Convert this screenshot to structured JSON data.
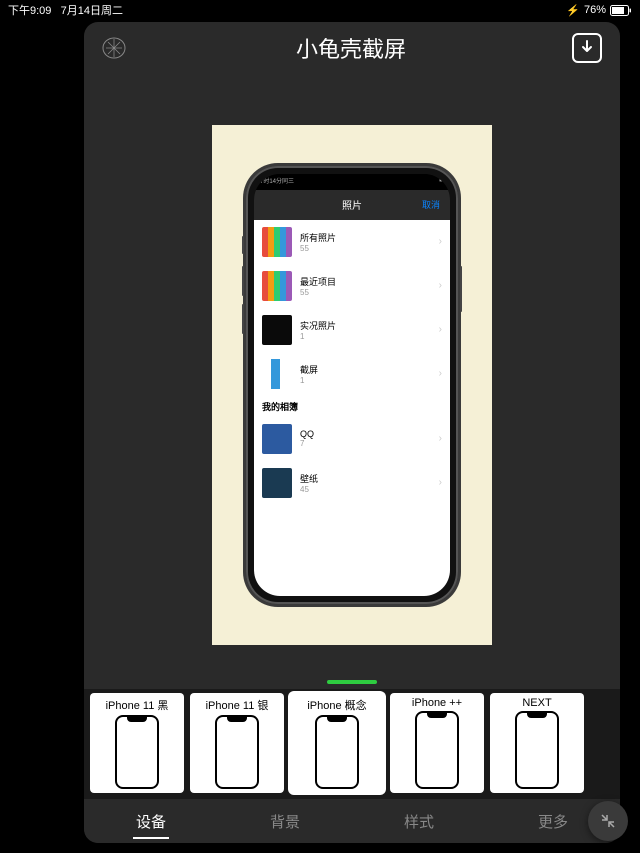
{
  "status": {
    "time": "下午9:09",
    "date": "7月14日周二",
    "charging_icon": "⚡",
    "battery": "76%"
  },
  "header": {
    "title": "小龟壳截屏"
  },
  "phone_screen": {
    "status_left": "7时14分同三",
    "nav_title": "照片",
    "nav_cancel": "取消",
    "section": "我的相簿",
    "albums": [
      {
        "name": "所有照片",
        "count": "55"
      },
      {
        "name": "最近项目",
        "count": "55"
      },
      {
        "name": "实况照片",
        "count": "1"
      },
      {
        "name": "截屏",
        "count": "1"
      },
      {
        "name": "QQ",
        "count": "7"
      },
      {
        "name": "壁纸",
        "count": "45"
      }
    ]
  },
  "styles": [
    {
      "label": "iPhone 11 黑"
    },
    {
      "label": "iPhone 11 银"
    },
    {
      "label": "iPhone 概念"
    },
    {
      "label": "iPhone ++"
    },
    {
      "label": "NEXT"
    }
  ],
  "tabs": [
    {
      "label": "设备"
    },
    {
      "label": "背景"
    },
    {
      "label": "样式"
    },
    {
      "label": "更多"
    }
  ]
}
